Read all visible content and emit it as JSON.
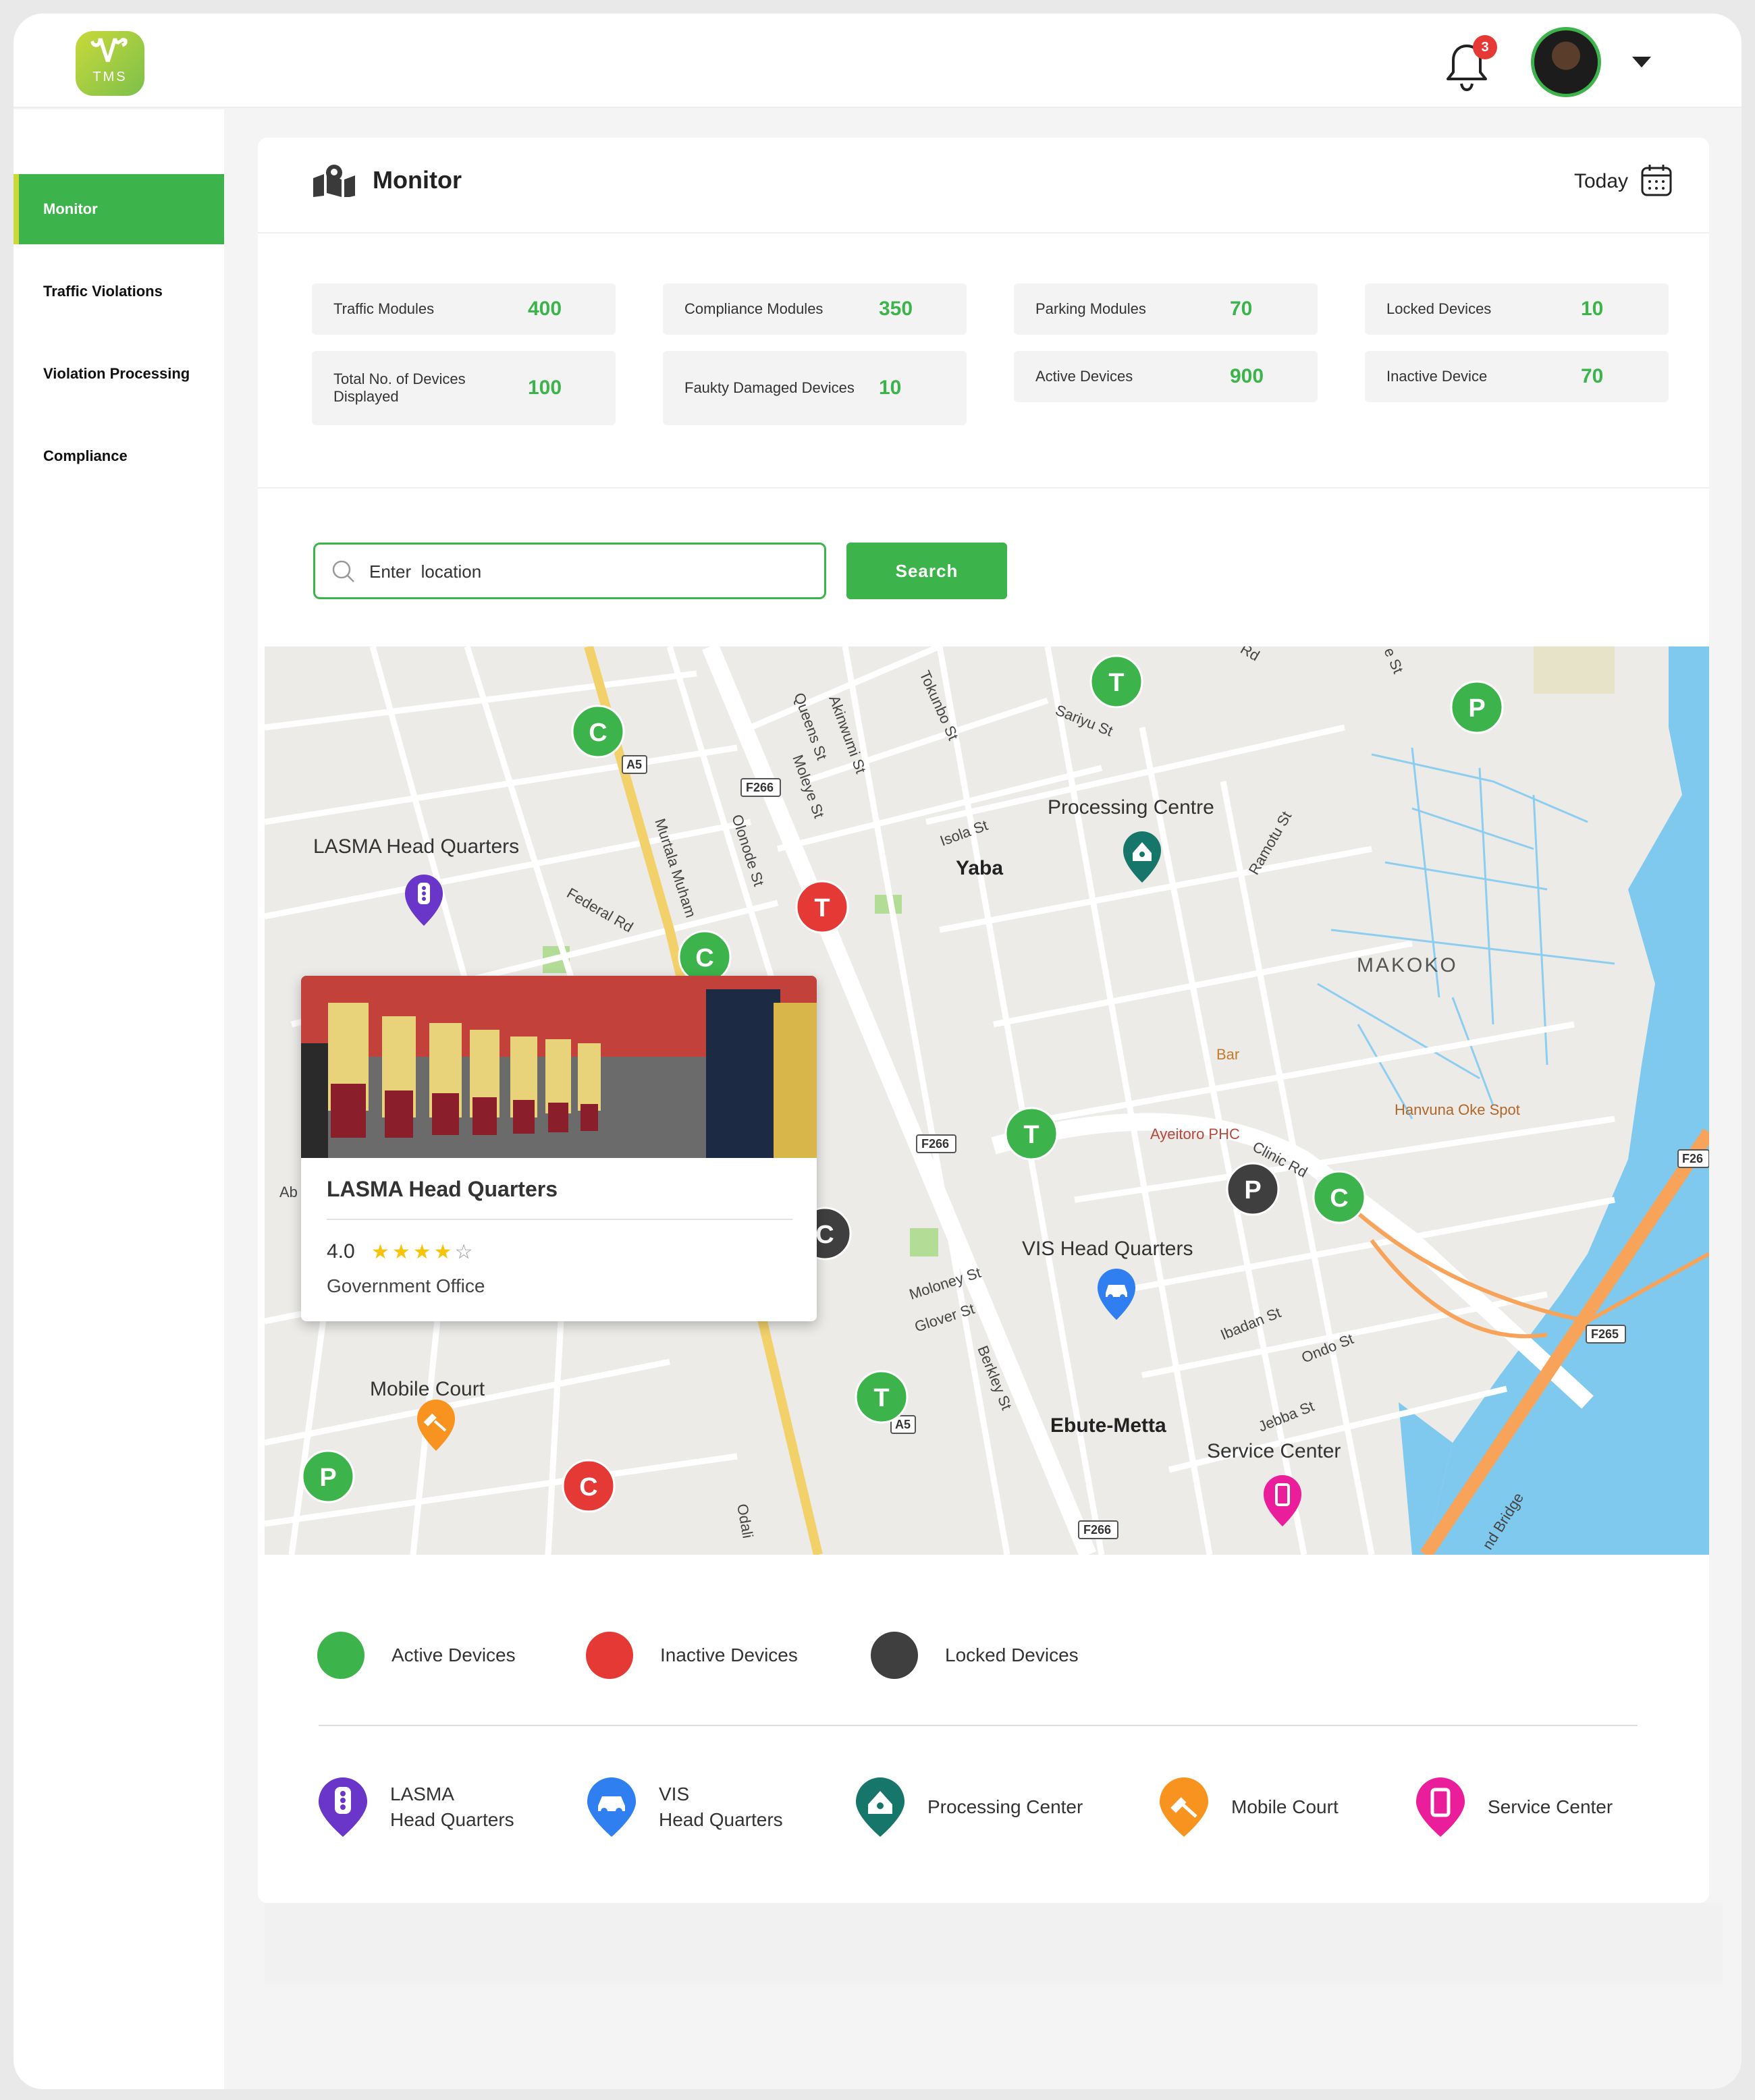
{
  "brand": {
    "logo_text": "TMS"
  },
  "header": {
    "notification_count": "3"
  },
  "sidebar": {
    "items": [
      {
        "label": "Monitor",
        "active": true
      },
      {
        "label": "Traffic Violations"
      },
      {
        "label": "Violation Processing"
      },
      {
        "label": "Compliance"
      }
    ]
  },
  "panel": {
    "title": "Monitor",
    "date_filter": "Today"
  },
  "stats": [
    {
      "label": "Traffic Modules",
      "value": "400"
    },
    {
      "label": "Compliance Modules",
      "value": "350"
    },
    {
      "label": "Parking Modules",
      "value": "70"
    },
    {
      "label": "Locked Devices",
      "value": "10"
    },
    {
      "label": "Total No. of Devices Displayed",
      "value": "100"
    },
    {
      "label": "Faukty Damaged Devices",
      "value": "10"
    },
    {
      "label": "Active Devices",
      "value": "900"
    },
    {
      "label": "Inactive Device",
      "value": "70"
    }
  ],
  "search": {
    "placeholder": "Enter  location",
    "button_label": "Search"
  },
  "map": {
    "places": {
      "lasma": "LASMA Head Quarters",
      "processing": "Processing Centre",
      "yaba": "Yaba",
      "makoko": "MAKOKO",
      "vis": "VIS Head Quarters",
      "ebute": "Ebute-Metta",
      "service": "Service Center",
      "mobile": "Mobile Court",
      "bar": "Bar",
      "ayeitoro": "Ayeitoro PHC",
      "hanvuna": "Hanvuna Oke Spot"
    },
    "streets": [
      "Murtala Muham",
      "Queens St",
      "Akinwumi St",
      "Tokunbo St",
      "Moleye St",
      "Olonode St",
      "Sariyu St",
      "Isola St",
      "Ramotu St",
      "Federal Rd",
      "Clinic Rd",
      "Moloney St",
      "Glover St",
      "Berkley St",
      "Ibadan St",
      "Ondo St",
      "Jebba St",
      "Rd",
      "e St",
      "Ab",
      "Odali",
      "nd Bridge"
    ],
    "road_badges": [
      "A5",
      "F266",
      "F266",
      "A5",
      "F266",
      "F265",
      "F26"
    ],
    "markers": [
      "C",
      "T",
      "P",
      "T",
      "C",
      "T",
      "P",
      "C",
      "C",
      "T",
      "P",
      "C"
    ],
    "popup": {
      "title": "LASMA Head Quarters",
      "rating": "4.0",
      "stars": "★★★★",
      "empty_star": "☆",
      "type": "Government Office"
    }
  },
  "status_legend": [
    {
      "label": "Active Devices",
      "color": "#3cb44b"
    },
    {
      "label": "Inactive Devices",
      "color": "#e53935"
    },
    {
      "label": "Locked Devices",
      "color": "#3f3f3f"
    }
  ],
  "pin_legend": [
    {
      "line1": "LASMA",
      "line2": "Head Quarters",
      "color": "#6a35c9",
      "icon": "traffic-light-icon"
    },
    {
      "line1": "VIS",
      "line2": "Head Quarters",
      "color": "#2f7ff0",
      "icon": "car-icon"
    },
    {
      "line1": "Processing Center",
      "line2": "",
      "color": "#17766a",
      "icon": "processing-house-icon"
    },
    {
      "line1": "Mobile Court",
      "line2": "",
      "color": "#f7931e",
      "icon": "gavel-icon"
    },
    {
      "line1": "Service Center",
      "line2": "",
      "color": "#ea1e9b",
      "icon": "phone-icon"
    }
  ]
}
